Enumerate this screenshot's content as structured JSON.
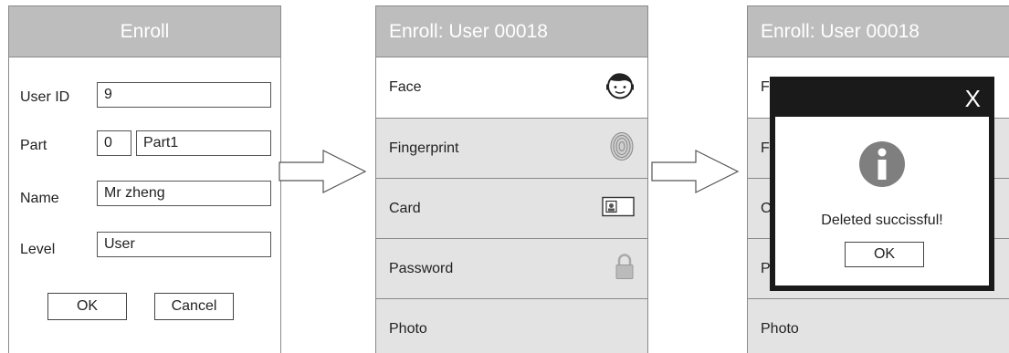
{
  "screen1": {
    "title": "Enroll",
    "fields": [
      {
        "label": "User ID",
        "value": "9"
      },
      {
        "label": "Part",
        "value_num": "0",
        "value": "Part1"
      },
      {
        "label": "Name",
        "value": "Mr zheng"
      },
      {
        "label": "Level",
        "value": "User"
      }
    ],
    "ok_label": "OK",
    "cancel_label": "Cancel"
  },
  "screen2": {
    "title": "Enroll: User 00018",
    "items": [
      {
        "label": "Face",
        "icon": "face-icon"
      },
      {
        "label": "Fingerprint",
        "icon": "fingerprint-icon"
      },
      {
        "label": "Card",
        "icon": "card-icon"
      },
      {
        "label": "Password",
        "icon": "lock-icon"
      },
      {
        "label": "Photo",
        "icon": ""
      }
    ]
  },
  "screen3": {
    "title": "Enroll: User 00018",
    "items": [
      {
        "label": "F"
      },
      {
        "label": "F"
      },
      {
        "label": "C"
      },
      {
        "label": "P"
      },
      {
        "label": "Photo"
      }
    ],
    "dialog": {
      "close_label": "X",
      "message": "Deleted succissful!",
      "ok_label": "OK",
      "icon": "info-icon"
    }
  },
  "colors": {
    "header_bg": "#bdbdbd",
    "row_bg": "#e3e3e3",
    "dialog_frame": "#1a1a1a",
    "info_icon": "#7f7f7f"
  }
}
